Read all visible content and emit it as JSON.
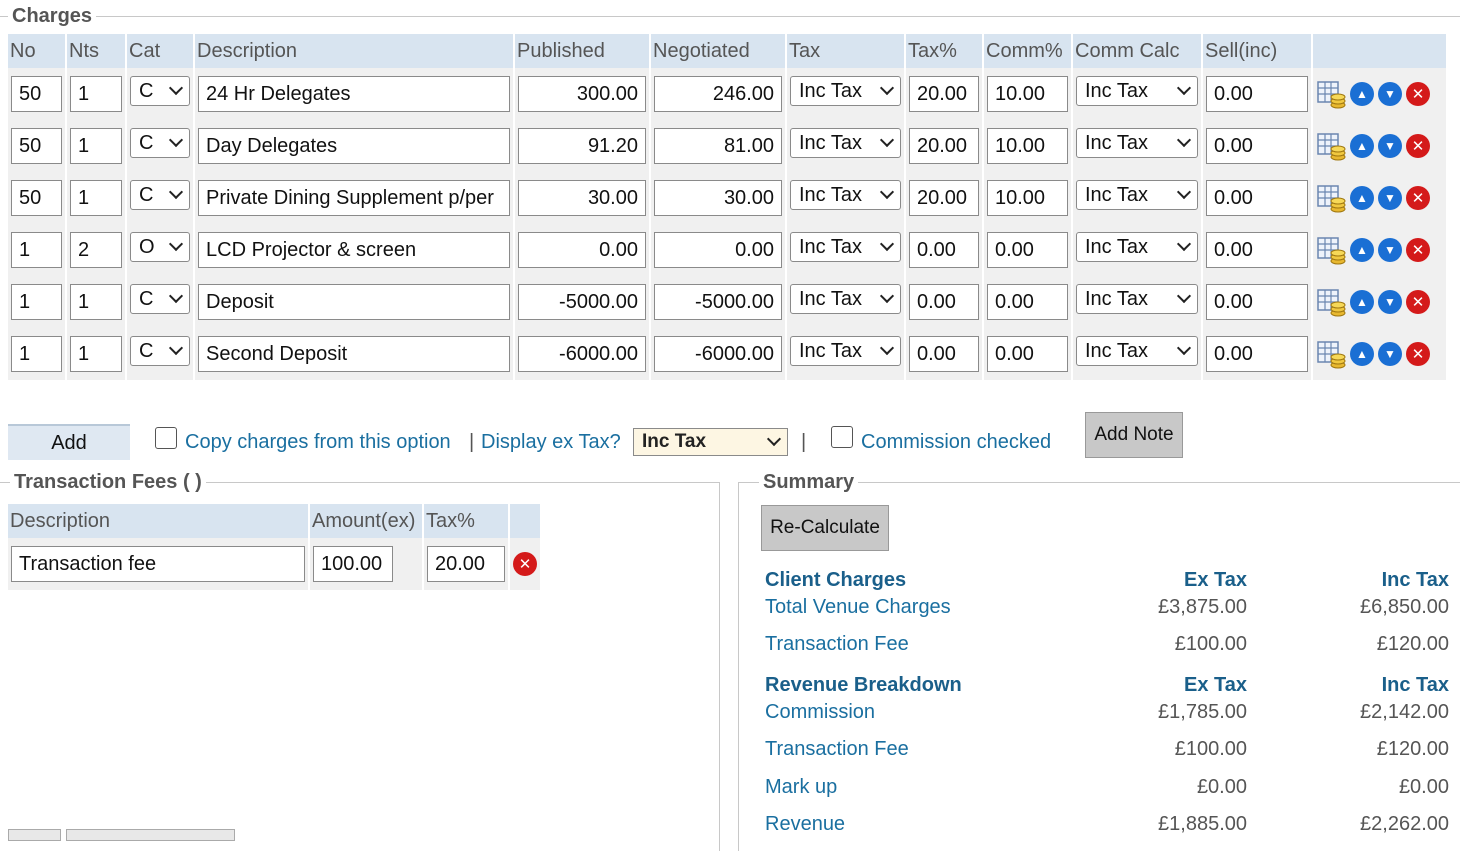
{
  "charges": {
    "legend": "Charges",
    "headers": [
      "No",
      "Nts",
      "Cat",
      "Description",
      "Published",
      "Negotiated",
      "Tax",
      "Tax%",
      "Comm%",
      "Comm Calc",
      "Sell(inc)"
    ],
    "rows": [
      {
        "no": "50",
        "nts": "1",
        "cat": "C",
        "description": "24 Hr Delegates",
        "published": "300.00",
        "negotiated": "246.00",
        "tax": "Inc Tax",
        "tax_pct": "20.00",
        "comm_pct": "10.00",
        "comm_calc": "Inc Tax",
        "sell": "0.00"
      },
      {
        "no": "50",
        "nts": "1",
        "cat": "C",
        "description": "Day Delegates",
        "published": "91.20",
        "negotiated": "81.00",
        "tax": "Inc Tax",
        "tax_pct": "20.00",
        "comm_pct": "10.00",
        "comm_calc": "Inc Tax",
        "sell": "0.00"
      },
      {
        "no": "50",
        "nts": "1",
        "cat": "C",
        "description": "Private Dining Supplement p/per",
        "published": "30.00",
        "negotiated": "30.00",
        "tax": "Inc Tax",
        "tax_pct": "20.00",
        "comm_pct": "10.00",
        "comm_calc": "Inc Tax",
        "sell": "0.00"
      },
      {
        "no": "1",
        "nts": "2",
        "cat": "O",
        "description": "LCD Projector & screen",
        "published": "0.00",
        "negotiated": "0.00",
        "tax": "Inc Tax",
        "tax_pct": "0.00",
        "comm_pct": "0.00",
        "comm_calc": "Inc Tax",
        "sell": "0.00"
      },
      {
        "no": "1",
        "nts": "1",
        "cat": "C",
        "description": "Deposit",
        "published": "-5000.00",
        "negotiated": "-5000.00",
        "tax": "Inc Tax",
        "tax_pct": "0.00",
        "comm_pct": "0.00",
        "comm_calc": "Inc Tax",
        "sell": "0.00"
      },
      {
        "no": "1",
        "nts": "1",
        "cat": "C",
        "description": "Second Deposit",
        "published": "-6000.00",
        "negotiated": "-6000.00",
        "tax": "Inc Tax",
        "tax_pct": "0.00",
        "comm_pct": "0.00",
        "comm_calc": "Inc Tax",
        "sell": "0.00"
      }
    ]
  },
  "controls": {
    "add_label": "Add",
    "copy_charges_label": "Copy charges from this option",
    "pipe": "|",
    "display_ex_tax_label": "Display ex Tax?",
    "display_tax_value": "Inc Tax",
    "commission_checked_label": "Commission checked",
    "add_note_label": "Add Note"
  },
  "transaction_fees": {
    "legend": "Transaction Fees ( )",
    "headers": [
      "Description",
      "Amount(ex)",
      "Tax%"
    ],
    "rows": [
      {
        "description": "Transaction fee",
        "amount": "100.00",
        "tax_pct": "20.00"
      }
    ]
  },
  "summary": {
    "legend": "Summary",
    "recalculate_label": "Re-Calculate",
    "client_heading": "Client Charges",
    "revenue_heading": "Revenue Breakdown",
    "ex_tax_heading": "Ex Tax",
    "inc_tax_heading": "Inc Tax",
    "client_rows": [
      {
        "label": "Total Venue Charges",
        "ex": "£3,875.00",
        "inc": "£6,850.00"
      },
      {
        "label": "Transaction Fee",
        "ex": "£100.00",
        "inc": "£120.00"
      }
    ],
    "revenue_rows": [
      {
        "label": "Commission",
        "ex": "£1,785.00",
        "inc": "£2,142.00"
      },
      {
        "label": "Transaction Fee",
        "ex": "£100.00",
        "inc": "£120.00"
      },
      {
        "label": "Mark up",
        "ex": "£0.00",
        "inc": "£0.00"
      },
      {
        "label": "Revenue",
        "ex": "£1,885.00",
        "inc": "£2,262.00"
      }
    ]
  },
  "colors": {
    "header_bg": "#d8e4f0",
    "link": "#1a6fa0",
    "delete_red": "#d41a1a",
    "move_blue": "#1a6fd4"
  }
}
